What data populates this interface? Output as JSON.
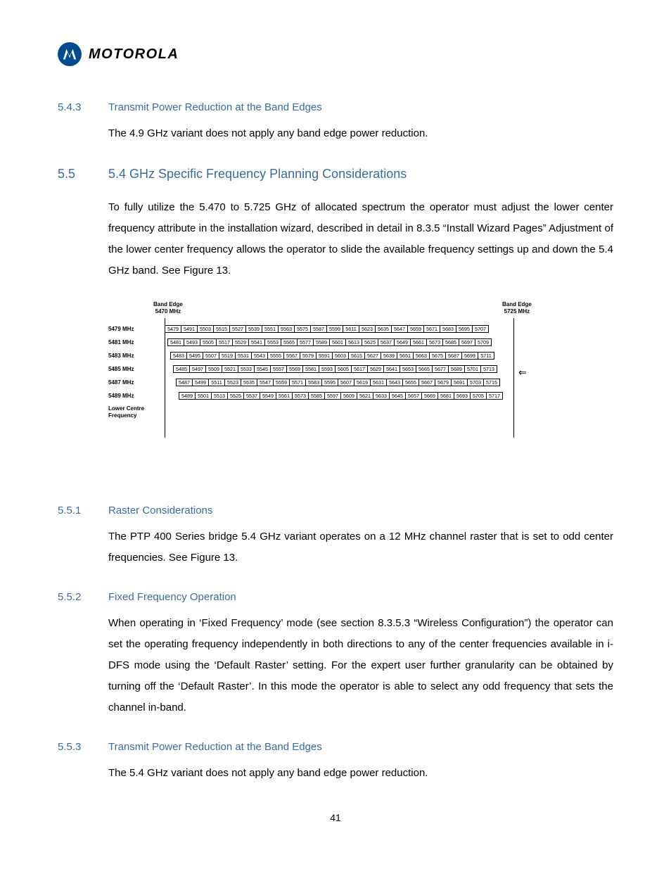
{
  "brand": "MOTOROLA",
  "sections": {
    "s543": {
      "num": "5.4.3",
      "title": "Transmit Power Reduction at the Band Edges",
      "body": "The 4.9 GHz variant does not apply any band edge power reduction."
    },
    "s55": {
      "num": "5.5",
      "title": "5.4 GHz Specific Frequency Planning Considerations",
      "body": "To fully utilize the 5.470 to 5.725 GHz of allocated spectrum the operator must adjust the lower center frequency attribute in the installation wizard, described in detail in 8.3.5 “Install Wizard Pages” Adjustment of the lower center frequency allows the operator to slide the available frequency settings up and down the 5.4 GHz band. See Figure 13."
    },
    "s551": {
      "num": "5.5.1",
      "title": "Raster Considerations",
      "body": "The PTP 400 Series bridge 5.4 GHz variant operates on a 12 MHz channel raster that is set to odd center frequencies. See Figure 13."
    },
    "s552": {
      "num": "5.5.2",
      "title": "Fixed Frequency Operation",
      "body": "When operating in ‘Fixed Frequency’ mode (see section 8.3.5.3 “Wireless Configuration”) the operator can set the operating frequency independently in both directions to any of the center frequencies available in i-DFS mode using the ‘Default Raster’ setting. For the expert user further granularity can be obtained by turning off the ‘Default Raster’. In this mode the operator is able to select any odd frequency that sets the channel in-band."
    },
    "s553": {
      "num": "5.5.3",
      "title": "Transmit Power Reduction at the Band Edges",
      "body": "The 5.4 GHz variant does not apply any band edge power reduction."
    }
  },
  "figure": {
    "band_edge_left": {
      "l1": "Band Edge",
      "l2": "5470 MHz"
    },
    "band_edge_right": {
      "l1": "Band Edge",
      "l2": "5725 MHz"
    },
    "lower_centre": {
      "l1": "Lower Centre",
      "l2": "Frequency"
    },
    "rows": [
      {
        "label": "5479 MHz",
        "offset": 0,
        "cells": [
          "5479",
          "5491",
          "5503",
          "5515",
          "5527",
          "5539",
          "5551",
          "5563",
          "5575",
          "5587",
          "5599",
          "5611",
          "5623",
          "5635",
          "5647",
          "5659",
          "5671",
          "5683",
          "5695",
          "5707"
        ]
      },
      {
        "label": "5481 MHz",
        "offset": 4,
        "cells": [
          "5481",
          "5493",
          "5505",
          "5517",
          "5529",
          "5541",
          "5553",
          "5565",
          "5577",
          "5589",
          "5601",
          "5613",
          "5625",
          "5637",
          "5649",
          "5661",
          "5673",
          "5685",
          "5697",
          "5709"
        ]
      },
      {
        "label": "5483 MHz",
        "offset": 8,
        "cells": [
          "5483",
          "5495",
          "5507",
          "5519",
          "5531",
          "5543",
          "5555",
          "5567",
          "5579",
          "5591",
          "5603",
          "5615",
          "5627",
          "5639",
          "5651",
          "5663",
          "5675",
          "5687",
          "5699",
          "5711"
        ]
      },
      {
        "label": "5485 MHz",
        "offset": 12,
        "cells": [
          "5485",
          "5497",
          "5509",
          "5521",
          "5533",
          "5545",
          "5557",
          "5569",
          "5581",
          "5593",
          "5605",
          "5617",
          "5629",
          "5641",
          "5653",
          "5665",
          "5677",
          "5689",
          "5701",
          "5713"
        ]
      },
      {
        "label": "5487 MHz",
        "offset": 16,
        "cells": [
          "5487",
          "5499",
          "5511",
          "5523",
          "5535",
          "5547",
          "5559",
          "5571",
          "5583",
          "5595",
          "5607",
          "5619",
          "5631",
          "5643",
          "5655",
          "5667",
          "5679",
          "5691",
          "5703",
          "5715"
        ]
      },
      {
        "label": "5489 MHz",
        "offset": 20,
        "cells": [
          "5489",
          "5501",
          "5513",
          "5525",
          "5537",
          "5549",
          "5561",
          "5573",
          "5585",
          "5597",
          "5609",
          "5621",
          "5633",
          "5645",
          "5657",
          "5669",
          "5681",
          "5693",
          "5705",
          "5717"
        ]
      }
    ]
  },
  "page_number": "41"
}
